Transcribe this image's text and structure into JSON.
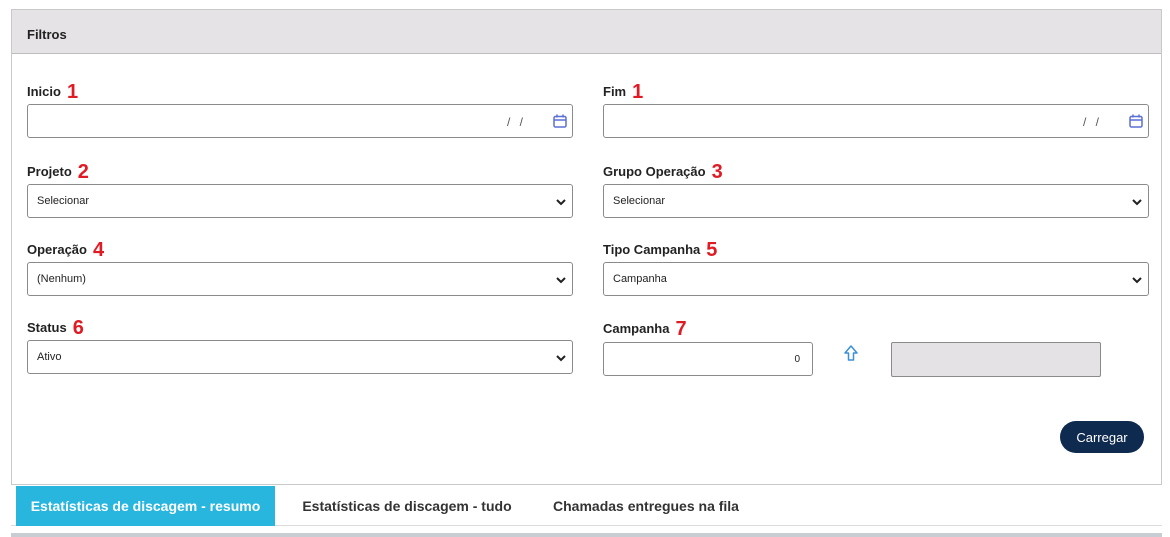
{
  "panel": {
    "title": "Filtros"
  },
  "fields": {
    "inicio": {
      "label": "Inicio",
      "number": "1",
      "date_placeholder": "/ /"
    },
    "fim": {
      "label": "Fim",
      "number": "1",
      "date_placeholder": "/ /"
    },
    "projeto": {
      "label": "Projeto",
      "number": "2",
      "value": "Selecionar"
    },
    "grupo_operacao": {
      "label": "Grupo Operação",
      "number": "3",
      "value": "Selecionar"
    },
    "operacao": {
      "label": "Operação",
      "number": "4",
      "value": "(Nenhum)"
    },
    "tipo_campanha": {
      "label": "Tipo Campanha",
      "number": "5",
      "value": "Campanha"
    },
    "status": {
      "label": "Status",
      "number": "6",
      "value": "Ativo"
    },
    "campanha": {
      "label": "Campanha",
      "number": "7",
      "value": "0"
    }
  },
  "buttons": {
    "load": "Carregar"
  },
  "tabs": [
    {
      "label": "Estatísticas de discagem - resumo",
      "active": true
    },
    {
      "label": "Estatísticas de discagem - tudo",
      "active": false
    },
    {
      "label": "Chamadas entregues na fila",
      "active": false
    }
  ],
  "icons": {
    "calendar": "calendar-icon",
    "dropdown": "chevron-down-icon",
    "upload": "arrow-up-icon"
  },
  "colors": {
    "annotation": "#e01b24",
    "header_bg": "#e6e3e6",
    "button_bg": "#0e2a4f",
    "active_tab": "#29b6de",
    "icon_accent": "#5b6fd6"
  }
}
